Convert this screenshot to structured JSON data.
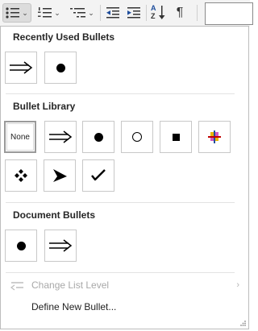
{
  "ribbon": {
    "buttons": [
      {
        "name": "bullets-button",
        "icon": "bullets-icon",
        "active": true
      },
      {
        "name": "numbering-button",
        "icon": "numbering-icon",
        "active": false
      },
      {
        "name": "multilevel-list-button",
        "icon": "multilevel-list-icon",
        "active": false
      },
      {
        "name": "decrease-indent-button",
        "icon": "decrease-indent-icon",
        "active": false
      },
      {
        "name": "increase-indent-button",
        "icon": "increase-indent-icon",
        "active": false
      },
      {
        "name": "sort-button",
        "icon": "sort-icon",
        "active": false
      },
      {
        "name": "show-formatting-marks-button",
        "icon": "pilcrow-icon",
        "active": false
      }
    ],
    "sort_label": "A",
    "sort_label2": "Z",
    "pilcrow": "¶"
  },
  "bullets_menu": {
    "recently_used": {
      "title": "Recently Used Bullets",
      "items": [
        {
          "name": "bullet-double-arrow",
          "icon": "double-arrow-icon"
        },
        {
          "name": "bullet-filled-circle",
          "icon": "filled-circle-icon"
        }
      ]
    },
    "library": {
      "title": "Bullet Library",
      "none_label": "None",
      "items": [
        {
          "name": "bullet-none",
          "icon": "none",
          "selected": true
        },
        {
          "name": "bullet-double-arrow",
          "icon": "double-arrow-icon"
        },
        {
          "name": "bullet-filled-circle",
          "icon": "filled-circle-icon"
        },
        {
          "name": "bullet-hollow-circle",
          "icon": "hollow-circle-icon"
        },
        {
          "name": "bullet-filled-square",
          "icon": "filled-square-icon"
        },
        {
          "name": "bullet-four-color-cross",
          "icon": "four-color-cross-icon"
        },
        {
          "name": "bullet-four-diamonds",
          "icon": "four-diamonds-icon"
        },
        {
          "name": "bullet-arrowhead",
          "icon": "arrowhead-icon"
        },
        {
          "name": "bullet-check-mark",
          "icon": "check-mark-icon"
        }
      ]
    },
    "document_bullets": {
      "title": "Document Bullets",
      "items": [
        {
          "name": "bullet-filled-circle",
          "icon": "filled-circle-icon"
        },
        {
          "name": "bullet-double-arrow",
          "icon": "double-arrow-icon"
        }
      ]
    },
    "change_list_level": {
      "label": "Change List Level",
      "enabled": false,
      "submenu_arrow": "›"
    },
    "define_new_bullet": {
      "label": "Define New Bullet..."
    }
  },
  "colors": {
    "ribbon_bg": "#f3f3f3",
    "active_button_bg": "#dcdcdc",
    "menu_border": "#bdbdbd",
    "disabled_text": "#a8a8a8",
    "cross_colors": [
      "#c00000",
      "#1f4e9c",
      "#e8b500",
      "#d15ac2"
    ]
  }
}
